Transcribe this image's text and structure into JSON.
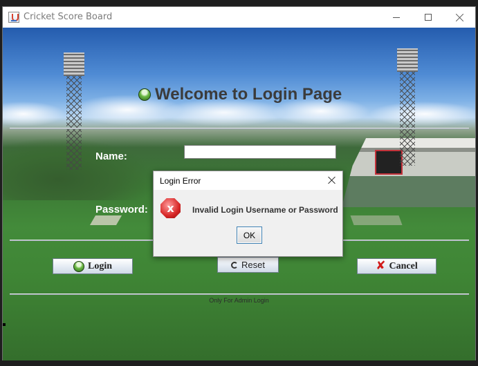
{
  "window": {
    "title": "Cricket Score Board",
    "icon": "java-cup-icon"
  },
  "login": {
    "heading": "Welcome to Login Page",
    "heading_icon": "green-ball-icon",
    "name_label": "Name:",
    "name_value": "",
    "password_label": "Password:",
    "buttons": {
      "login": "Login",
      "reset": "Reset",
      "cancel": "Cancel"
    },
    "footer_note": "Only For Admin Login"
  },
  "dialog": {
    "title": "Login Error",
    "message": "Invalid Login Username or Password",
    "ok_label": "OK",
    "icon": "error-icon"
  },
  "colors": {
    "error": "#d72626",
    "heading": "#3b3b3b",
    "label": "#ffffff"
  }
}
